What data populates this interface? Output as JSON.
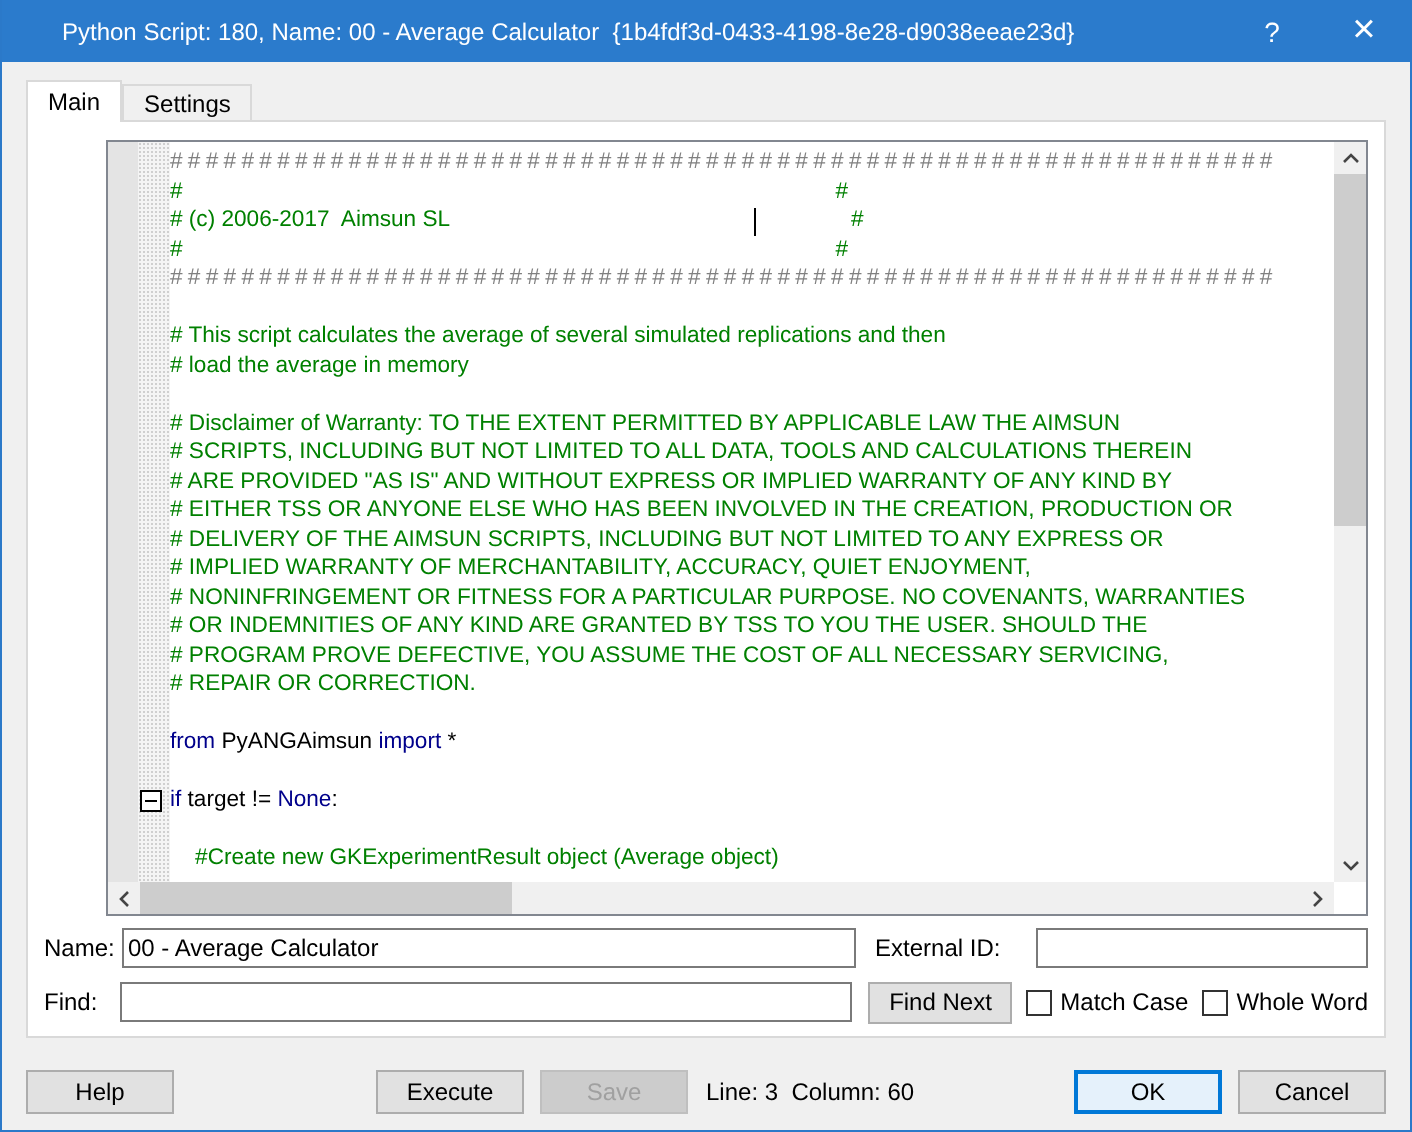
{
  "window": {
    "title": "Python Script: 180, Name: 00 - Average Calculator  {1b4fdf3d-0433-4198-8e28-d9038eeae23d}",
    "help": "?",
    "close": "×"
  },
  "tabs": [
    {
      "label": "Main",
      "selected": true
    },
    {
      "label": "Settings",
      "selected": false
    }
  ],
  "editor": {
    "blocks": [
      [
        {
          "segments": [
            {
              "kind": "rule",
              "text": "##############################################################"
            }
          ]
        },
        {
          "segments": [
            {
              "kind": "comment",
              "text": "#                                                                                                        #"
            }
          ]
        },
        {
          "segments": [
            {
              "kind": "comment",
              "text": "# (c) 2006-2017  Aimsun SL                                                                #"
            }
          ],
          "caret": true
        },
        {
          "segments": [
            {
              "kind": "comment",
              "text": "#                                                                                                        #"
            }
          ]
        },
        {
          "segments": [
            {
              "kind": "rule",
              "text": "##############################################################"
            }
          ]
        }
      ],
      [
        {
          "segments": [
            {
              "kind": "comment",
              "text": "# This script calculates the average of several simulated replications and then"
            }
          ]
        },
        {
          "segments": [
            {
              "kind": "comment",
              "text": "# load the average in memory"
            }
          ]
        }
      ],
      [
        {
          "segments": [
            {
              "kind": "comment",
              "text": "# Disclaimer of Warranty: TO THE EXTENT PERMITTED BY APPLICABLE LAW THE AIMSUN"
            }
          ]
        },
        {
          "segments": [
            {
              "kind": "comment",
              "text": "# SCRIPTS, INCLUDING BUT NOT LIMITED TO ALL DATA, TOOLS AND CALCULATIONS THEREIN"
            }
          ]
        },
        {
          "segments": [
            {
              "kind": "comment",
              "text": "# ARE PROVIDED \"AS IS\" AND WITHOUT EXPRESS OR IMPLIED WARRANTY OF ANY KIND BY"
            }
          ]
        },
        {
          "segments": [
            {
              "kind": "comment",
              "text": "# EITHER TSS OR ANYONE ELSE WHO HAS BEEN INVOLVED IN THE CREATION, PRODUCTION OR"
            }
          ]
        },
        {
          "segments": [
            {
              "kind": "comment",
              "text": "# DELIVERY OF THE AIMSUN SCRIPTS, INCLUDING BUT NOT LIMITED TO ANY EXPRESS OR"
            }
          ]
        },
        {
          "segments": [
            {
              "kind": "comment",
              "text": "# IMPLIED WARRANTY OF MERCHANTABILITY, ACCURACY, QUIET ENJOYMENT,"
            }
          ]
        },
        {
          "segments": [
            {
              "kind": "comment",
              "text": "# NONINFRINGEMENT OR FITNESS FOR A PARTICULAR PURPOSE. NO COVENANTS, WARRANTIES"
            }
          ]
        },
        {
          "segments": [
            {
              "kind": "comment",
              "text": "# OR INDEMNITIES OF ANY KIND ARE GRANTED BY TSS TO YOU THE USER. SHOULD THE"
            }
          ]
        },
        {
          "segments": [
            {
              "kind": "comment",
              "text": "# PROGRAM PROVE DEFECTIVE, YOU ASSUME THE COST OF ALL NECESSARY SERVICING,"
            }
          ]
        },
        {
          "segments": [
            {
              "kind": "comment",
              "text": "# REPAIR OR CORRECTION."
            }
          ]
        }
      ],
      [
        {
          "segments": [
            {
              "kind": "keyword",
              "text": "from"
            },
            {
              "kind": "plain",
              "text": " PyANGAimsun "
            },
            {
              "kind": "keyword",
              "text": "import"
            },
            {
              "kind": "plain",
              "text": " *"
            }
          ]
        }
      ],
      [
        {
          "segments": [
            {
              "kind": "keyword",
              "text": "if"
            },
            {
              "kind": "plain",
              "text": " target != "
            },
            {
              "kind": "keyword",
              "text": "None"
            },
            {
              "kind": "plain",
              "text": ":"
            }
          ],
          "fold": {
            "expanded": true
          }
        }
      ],
      [
        {
          "segments": [
            {
              "kind": "comment",
              "text": "    #Create new GKExperimentResult object (Average object)"
            }
          ]
        }
      ]
    ]
  },
  "form": {
    "name_label": "Name:",
    "name_value": "00 - Average Calculator",
    "external_id_label": "External ID:",
    "find_label": "Find:",
    "find_next": "Find Next",
    "options": [
      {
        "label": "Match Case",
        "checked": false
      },
      {
        "label": "Whole Word",
        "checked": false
      }
    ]
  },
  "footer": {
    "left": [
      {
        "label": "Help",
        "disabled": false,
        "default": false
      }
    ],
    "middle": [
      {
        "label": "Execute",
        "disabled": false,
        "default": false
      },
      {
        "label": "Save",
        "disabled": true,
        "default": false
      }
    ],
    "status": "Line: 3  Column: 60",
    "right": [
      {
        "label": "OK",
        "disabled": false,
        "default": true
      },
      {
        "label": "Cancel",
        "disabled": false,
        "default": false
      }
    ]
  }
}
